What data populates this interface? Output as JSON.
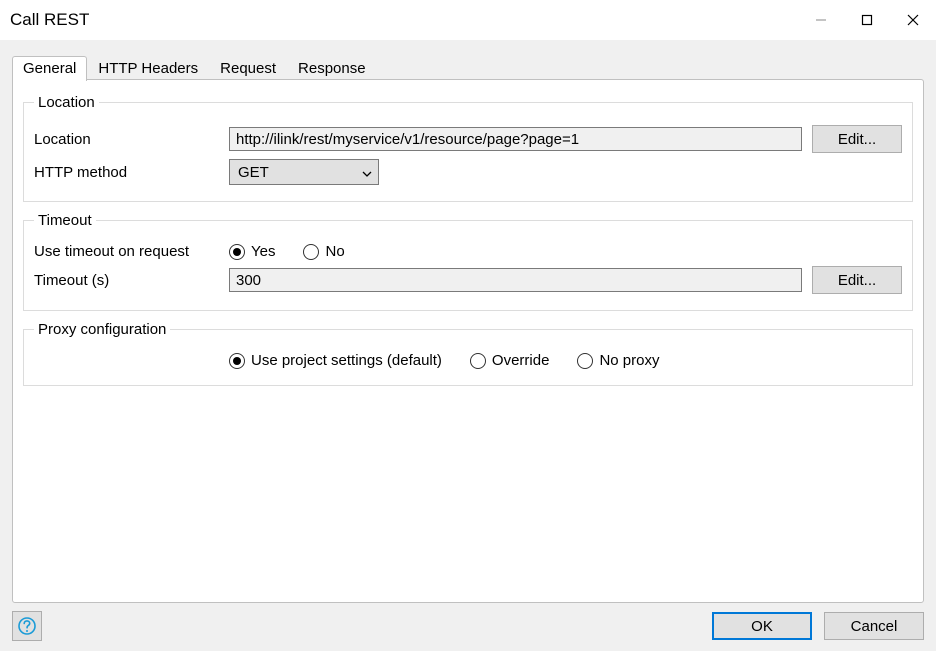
{
  "window": {
    "title": "Call REST"
  },
  "tabs": {
    "general": "General",
    "http_headers": "HTTP Headers",
    "request": "Request",
    "response": "Response"
  },
  "location_group": {
    "legend": "Location",
    "location_label": "Location",
    "location_value": "http://ilink/rest/myservice/v1/resource/page?page=1",
    "edit_label": "Edit...",
    "method_label": "HTTP method",
    "method_value": "GET"
  },
  "timeout_group": {
    "legend": "Timeout",
    "use_timeout_label": "Use timeout on request",
    "yes": "Yes",
    "no": "No",
    "timeout_label": "Timeout (s)",
    "timeout_value": "300",
    "edit_label": "Edit..."
  },
  "proxy_group": {
    "legend": "Proxy configuration",
    "use_project": "Use project settings (default)",
    "override": "Override",
    "no_proxy": "No proxy"
  },
  "footer": {
    "ok": "OK",
    "cancel": "Cancel"
  }
}
